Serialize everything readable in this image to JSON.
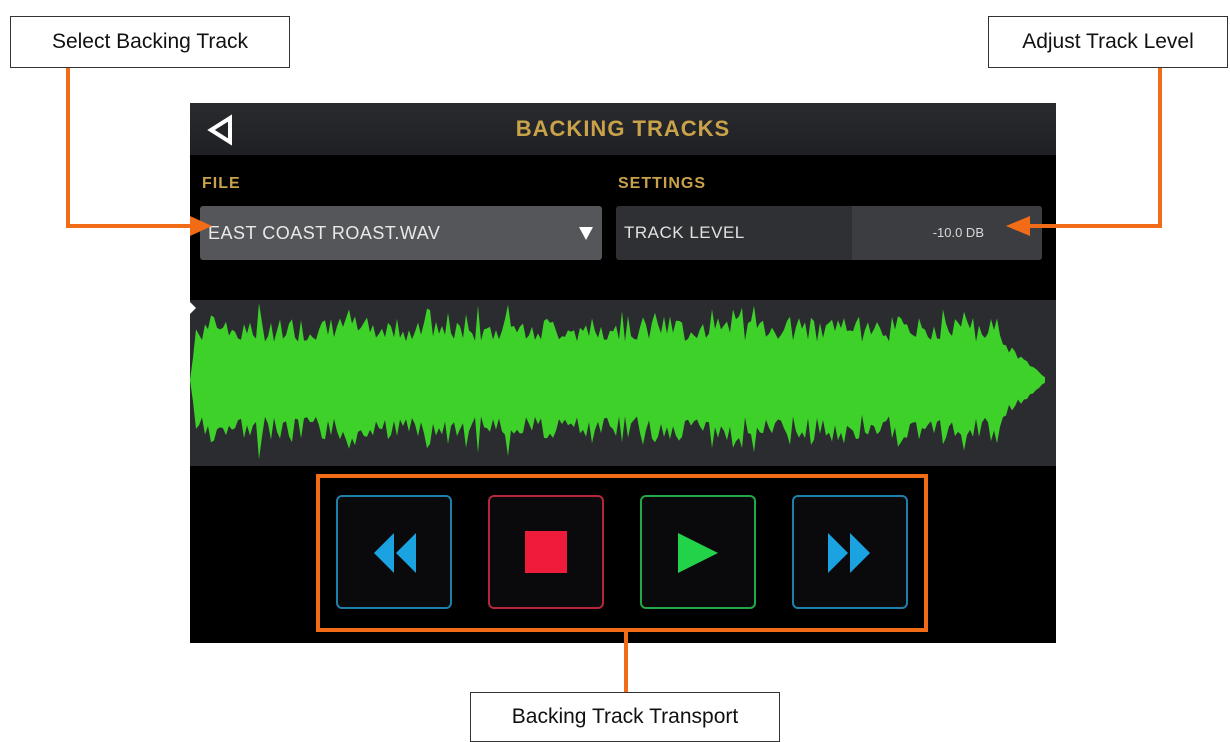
{
  "callouts": {
    "select_backing_track": "Select Backing Track",
    "adjust_track_level": "Adjust Track Level",
    "backing_track_transport": "Backing Track Transport"
  },
  "header": {
    "title": "BACKING TRACKS",
    "back_icon": "back-triangle-icon"
  },
  "file": {
    "label": "FILE",
    "selected_value": "EAST COAST ROAST.WAV",
    "dropdown_icon": "chevron-down-icon"
  },
  "settings": {
    "label": "SETTINGS",
    "track_level_label": "TRACK LEVEL",
    "track_level_value": "-10.0 DB"
  },
  "transport": {
    "buttons": [
      {
        "name": "rewind",
        "icon": "rewind-icon",
        "color": "#1aa3e0"
      },
      {
        "name": "stop",
        "icon": "stop-icon",
        "color": "#ee1b3a"
      },
      {
        "name": "play",
        "icon": "play-icon",
        "color": "#22d34a"
      },
      {
        "name": "fast-forward",
        "icon": "fast-forward-icon",
        "color": "#1aa3e0"
      }
    ]
  },
  "colors": {
    "annotation_orange": "#f26b16",
    "header_gold": "#c9a24a",
    "waveform_green": "#3dd12a",
    "screen_background": "#000000"
  }
}
